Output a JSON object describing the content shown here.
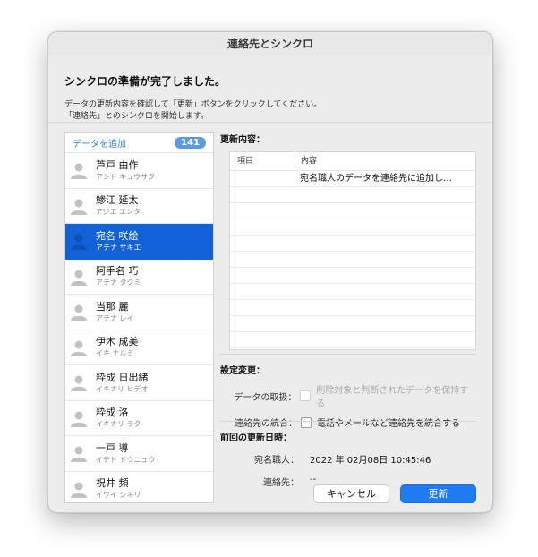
{
  "window": {
    "title": "連絡先とシンクロ"
  },
  "header": {
    "heading": "シンクロの準備が完了しました。",
    "message_line1": "データの更新内容を確認して「更新」ボタンをクリックしてください。",
    "message_line2": "「連絡先」とのシンクロを開始します。"
  },
  "sidebar": {
    "add_label": "データを追加",
    "count": "141",
    "contacts": [
      {
        "name": "芦戸 由作",
        "kana": "アシド キュウサク",
        "selected": false
      },
      {
        "name": "鯵江 延太",
        "kana": "アジエ エンタ",
        "selected": false
      },
      {
        "name": "宛名 咲絵",
        "kana": "アテナ サキエ",
        "selected": true
      },
      {
        "name": "阿手名 巧",
        "kana": "アテナ タクミ",
        "selected": false
      },
      {
        "name": "当那 麗",
        "kana": "アテナ レイ",
        "selected": false
      },
      {
        "name": "伊木 成美",
        "kana": "イキ ナルミ",
        "selected": false
      },
      {
        "name": "粋成 日出緒",
        "kana": "イキナリ ヒデオ",
        "selected": false
      },
      {
        "name": "粋成 洛",
        "kana": "イキナリ ラク",
        "selected": false
      },
      {
        "name": "一戸 導",
        "kana": "イチド ドウニュウ",
        "selected": false
      },
      {
        "name": "祝井 頻",
        "kana": "イワイ シキリ",
        "selected": false
      }
    ]
  },
  "changes": {
    "title": "更新内容：",
    "columns": {
      "item": "項目",
      "content": "内容"
    },
    "rows": [
      {
        "item": "",
        "content": "宛名職人のデータを連絡先に追加し…"
      }
    ]
  },
  "settings": {
    "title": "設定変更：",
    "data_handling_label": "データの取扱：",
    "data_handling_option": "削除対象と判断されたデータを保持する",
    "merge_label": "連絡先の統合：",
    "merge_option": "電話やメールなど連絡先を統合する"
  },
  "last_update": {
    "title": "前回の更新日時：",
    "atena_label": "宛名職人：",
    "atena_value": "2022 年 02月08日 10:45:46",
    "contacts_label": "連絡先：",
    "contacts_value": "--"
  },
  "buttons": {
    "cancel": "キャンセル",
    "update": "更新"
  }
}
